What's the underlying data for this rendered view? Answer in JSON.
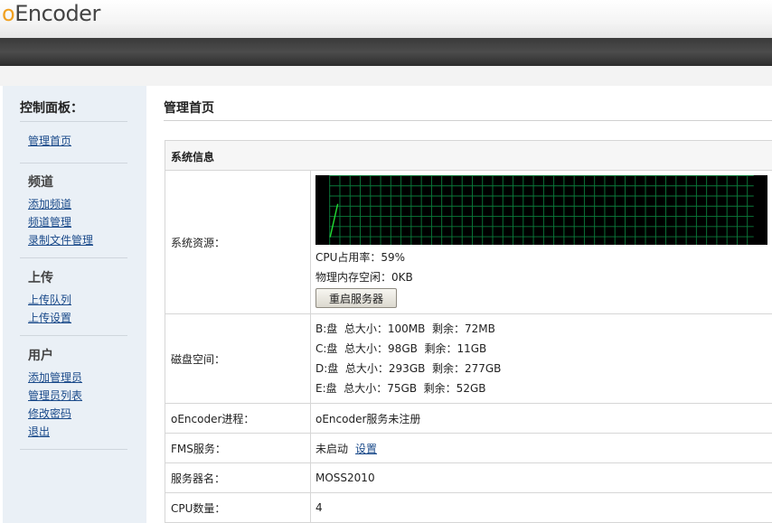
{
  "header": {
    "logo_o": "o",
    "logo_rest": "Encoder"
  },
  "sidebar": {
    "title": "控制面板：",
    "home_link": "管理首页",
    "groups": [
      {
        "heading": "频道",
        "links": [
          "添加频道",
          "频道管理",
          "录制文件管理"
        ]
      },
      {
        "heading": "上传",
        "links": [
          "上传队列",
          "上传设置"
        ]
      },
      {
        "heading": "用户",
        "links": [
          "添加管理员",
          "管理员列表",
          "修改密码",
          "退出"
        ]
      }
    ]
  },
  "main": {
    "title": "管理首页",
    "section_title": "系统信息",
    "resources": {
      "label": "系统资源：",
      "cpu_usage": "CPU占用率：59%",
      "memory_free": "物理内存空闲：0KB",
      "restart_button": "重启服务器",
      "cpu_graph_samples": [
        10,
        59
      ]
    },
    "disk": {
      "label": "磁盘空间：",
      "lines": [
        "B:盘  总大小：100MB  剩余：72MB",
        "C:盘  总大小：98GB  剩余：11GB",
        "D:盘  总大小：293GB  剩余：277GB",
        "E:盘  总大小：75GB  剩余：52GB"
      ]
    },
    "process": {
      "label": "oEncoder进程：",
      "value": "oEncoder服务未注册"
    },
    "fms": {
      "label": "FMS服务：",
      "value": "未启动",
      "link": "设置"
    },
    "server_name": {
      "label": "服务器名：",
      "value": "MOSS2010"
    },
    "cpu_count": {
      "label": "CPU数量：",
      "value": "4"
    }
  },
  "colors": {
    "graph_grid": "#0a7a3a",
    "graph_line": "#22dd33",
    "link": "#1a4a8a",
    "sidebar_bg": "#eaf0f6"
  }
}
